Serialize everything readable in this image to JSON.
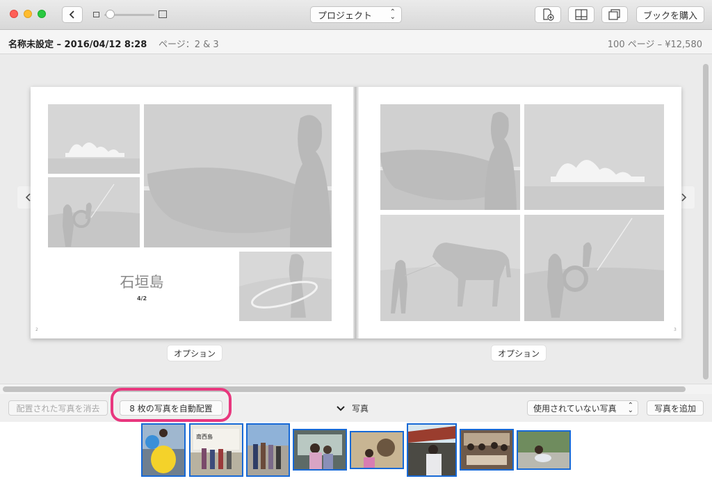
{
  "toolbar": {
    "project_select": "プロジェクト",
    "buy_book": "ブックを購入"
  },
  "info": {
    "doc_title": "名称未設定 – 2016/04/12 8:28",
    "pages": "ページ：2 & 3",
    "price": "100 ページ – ¥12,580"
  },
  "book": {
    "title": "石垣島",
    "date": "4/2",
    "left_page_num": "2",
    "right_page_num": "3"
  },
  "options": {
    "left": "オプション",
    "right": "オプション"
  },
  "bottom": {
    "clear_placed": "配置された写真を消去",
    "auto_place": "8 枚の写真を自動配置",
    "photos_label": "写真",
    "unused_select": "使用されていない写真",
    "add_photos": "写真を追加"
  },
  "icons": {
    "back": "chevron-left-icon",
    "nav_prev": "chevron-left-icon",
    "nav_next": "chevron-right-icon",
    "add_page": "add-page-icon",
    "layout": "layout-icon",
    "pages_view": "pages-icon",
    "photos_toggle": "chevron-down-icon"
  },
  "colors": {
    "highlight": "#e8377e",
    "selection": "#1769d6",
    "close": "#fe5f57",
    "minimize": "#febc2e",
    "maximize": "#28c840"
  }
}
